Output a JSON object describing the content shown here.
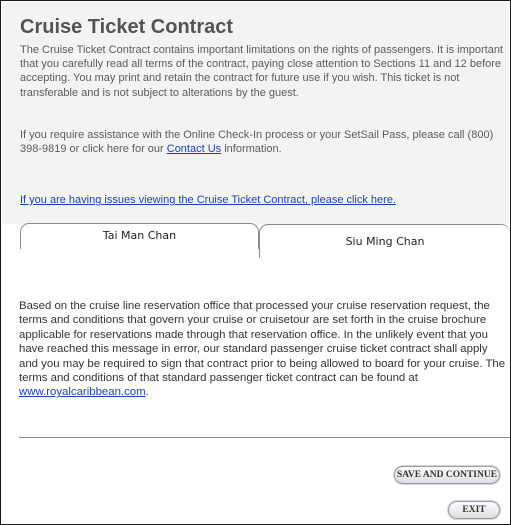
{
  "contract": {
    "title": "Cruise Ticket Contract",
    "intro": "The Cruise Ticket Contract contains important limitations on the rights of passengers. It is important that you carefully read all terms of the contract, paying close attention to Sections 11 and 12 before accepting. You may print and retain the contract for future use if you wish. This ticket is not transferable and is not subject to alterations by the guest.",
    "assistance_before": "If you require assistance with the Online Check-In process or your SetSail Pass, please call (800) 398-9819 or click here for our ",
    "contact_link": "Contact Us",
    "assistance_after": " information.",
    "viewing_link": "If you are having issues viewing the Cruise Ticket Contract, please click here."
  },
  "tabs": [
    {
      "label": "Tai Man Chan",
      "selected": false
    },
    {
      "label": "Siu Ming Chan",
      "selected": true
    }
  ],
  "terms": {
    "text": "Based on the cruise line reservation office that processed your cruise reservation request, the terms and conditions that govern your cruise or cruisetour are set forth in the cruise brochure applicable for reservations made through that reservation office. In the unlikely event that you have reached this message in error, our standard passenger cruise ticket contract shall apply and you may be required to sign that contract prior to being allowed to board for your cruise. The terms and conditions of that standard passenger ticket contract can be found at ",
    "link": "www.royalcaribbean.com",
    "end": "."
  },
  "buttons": {
    "save_continue": "SAVE AND CONTINUE",
    "exit": "EXIT"
  }
}
